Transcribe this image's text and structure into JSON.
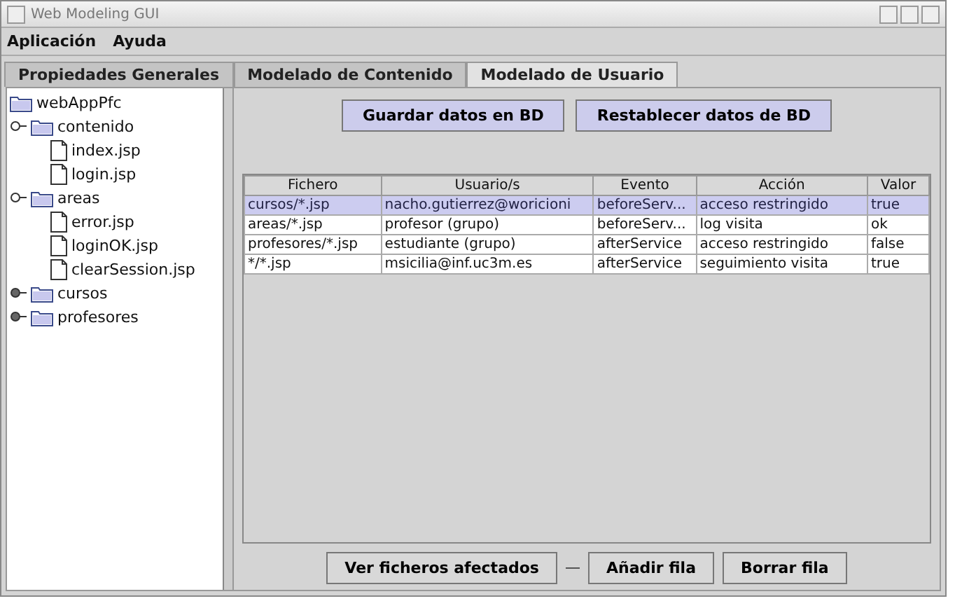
{
  "window": {
    "title": "Web Modeling GUI"
  },
  "menu": [
    "Aplicación",
    "Ayuda"
  ],
  "tabs": [
    {
      "label": "Propiedades Generales",
      "selected": false
    },
    {
      "label": "Modelado de Contenido",
      "selected": false
    },
    {
      "label": "Modelado de Usuario",
      "selected": true
    }
  ],
  "tree": {
    "label": "webAppPfc",
    "children": [
      {
        "label": "contenido",
        "kind": "folder",
        "expanded": true,
        "children": [
          {
            "label": "index.jsp",
            "kind": "file"
          },
          {
            "label": "login.jsp",
            "kind": "file"
          }
        ]
      },
      {
        "label": "areas",
        "kind": "folder",
        "expanded": true,
        "children": [
          {
            "label": "error.jsp",
            "kind": "file"
          },
          {
            "label": "loginOK.jsp",
            "kind": "file"
          },
          {
            "label": "clearSession.jsp",
            "kind": "file"
          }
        ]
      },
      {
        "label": "cursos",
        "kind": "folder",
        "expanded": false
      },
      {
        "label": "profesores",
        "kind": "folder",
        "expanded": false
      }
    ]
  },
  "top_buttons": [
    "Guardar datos en BD",
    "Restablecer datos de BD"
  ],
  "table": {
    "columns": [
      "Fichero",
      "Usuario/s",
      "Evento",
      "Acción",
      "Valor"
    ],
    "rows": [
      {
        "cells": [
          "cursos/*.jsp",
          "nacho.gutierrez@woricioni",
          "beforeServ...",
          "acceso restringido",
          "true"
        ],
        "selected": true
      },
      {
        "cells": [
          "areas/*.jsp",
          "profesor (grupo)",
          "beforeServ...",
          "log visita",
          "ok"
        ],
        "selected": false
      },
      {
        "cells": [
          "profesores/*.jsp",
          "estudiante (grupo)",
          "afterService",
          "acceso restringido",
          "false"
        ],
        "selected": false
      },
      {
        "cells": [
          "*/*.jsp",
          "msicilia@inf.uc3m.es",
          "afterService",
          "seguimiento visita",
          "true"
        ],
        "selected": false
      }
    ]
  },
  "bottom_buttons": [
    "Ver ficheros afectados",
    "Añadir fila",
    "Borrar fila"
  ]
}
